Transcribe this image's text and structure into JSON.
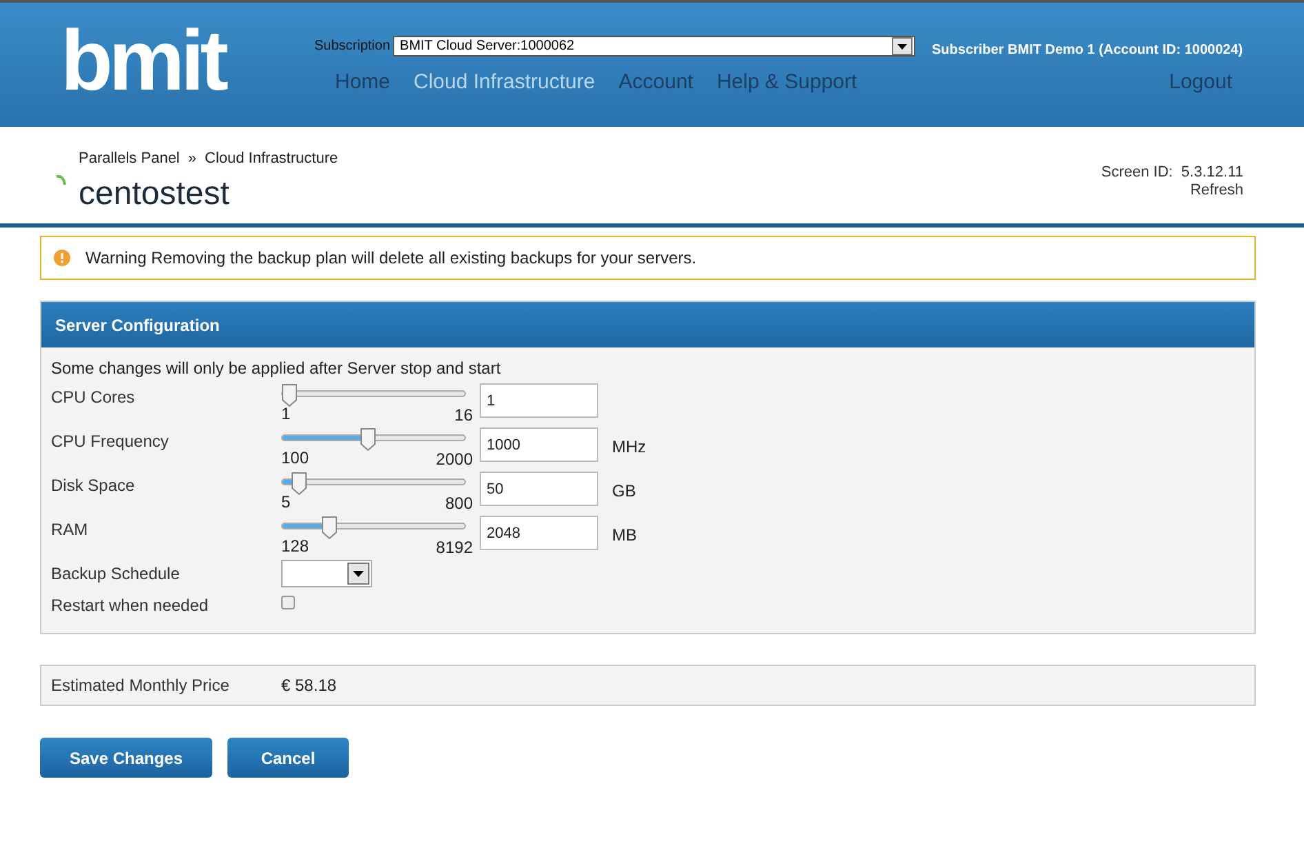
{
  "header": {
    "logo": "bmit",
    "subscription_label": "Subscription",
    "subscription_value": "BMIT Cloud Server:1000062",
    "subscriber": "Subscriber BMIT Demo 1 (Account ID: 1000024)",
    "nav": [
      {
        "label": "Home",
        "selected": false
      },
      {
        "label": "Cloud Infrastructure",
        "selected": true
      },
      {
        "label": "Account",
        "selected": false
      },
      {
        "label": "Help & Support",
        "selected": false
      }
    ],
    "logout": "Logout"
  },
  "breadcrumb": [
    "Parallels Panel",
    "»",
    "Cloud Infrastructure"
  ],
  "page_title": "centostest",
  "screen_id": "Screen ID:  5.3.12.11",
  "refresh": "Refresh",
  "warning": "Warning Removing the backup plan will delete all existing backups for your servers.",
  "panel": {
    "title": "Server Configuration",
    "note": "Some changes will only be applied after Server stop and start",
    "rows": [
      {
        "kind": "slider",
        "label": "CPU Cores",
        "min": "1",
        "max": "16",
        "level": 0,
        "value": "1",
        "unit": ""
      },
      {
        "kind": "slider",
        "label": "CPU Frequency",
        "min": "100",
        "max": "2000",
        "level": 0.47,
        "value": "1000",
        "unit": "MHz"
      },
      {
        "kind": "slider",
        "label": "Disk Space",
        "min": "5",
        "max": "800",
        "level": 0.06,
        "value": "50",
        "unit": "GB"
      },
      {
        "kind": "slider",
        "label": "RAM",
        "min": "128",
        "max": "8192",
        "level": 0.24,
        "value": "2048",
        "unit": "MB"
      },
      {
        "kind": "select",
        "label": "Backup Schedule"
      },
      {
        "kind": "checkbox",
        "label": "Restart when needed",
        "checked": false
      }
    ]
  },
  "price": {
    "label": "Estimated Monthly Price",
    "value": "€ 58.18"
  },
  "buttons": [
    "Save Changes",
    "Cancel"
  ]
}
